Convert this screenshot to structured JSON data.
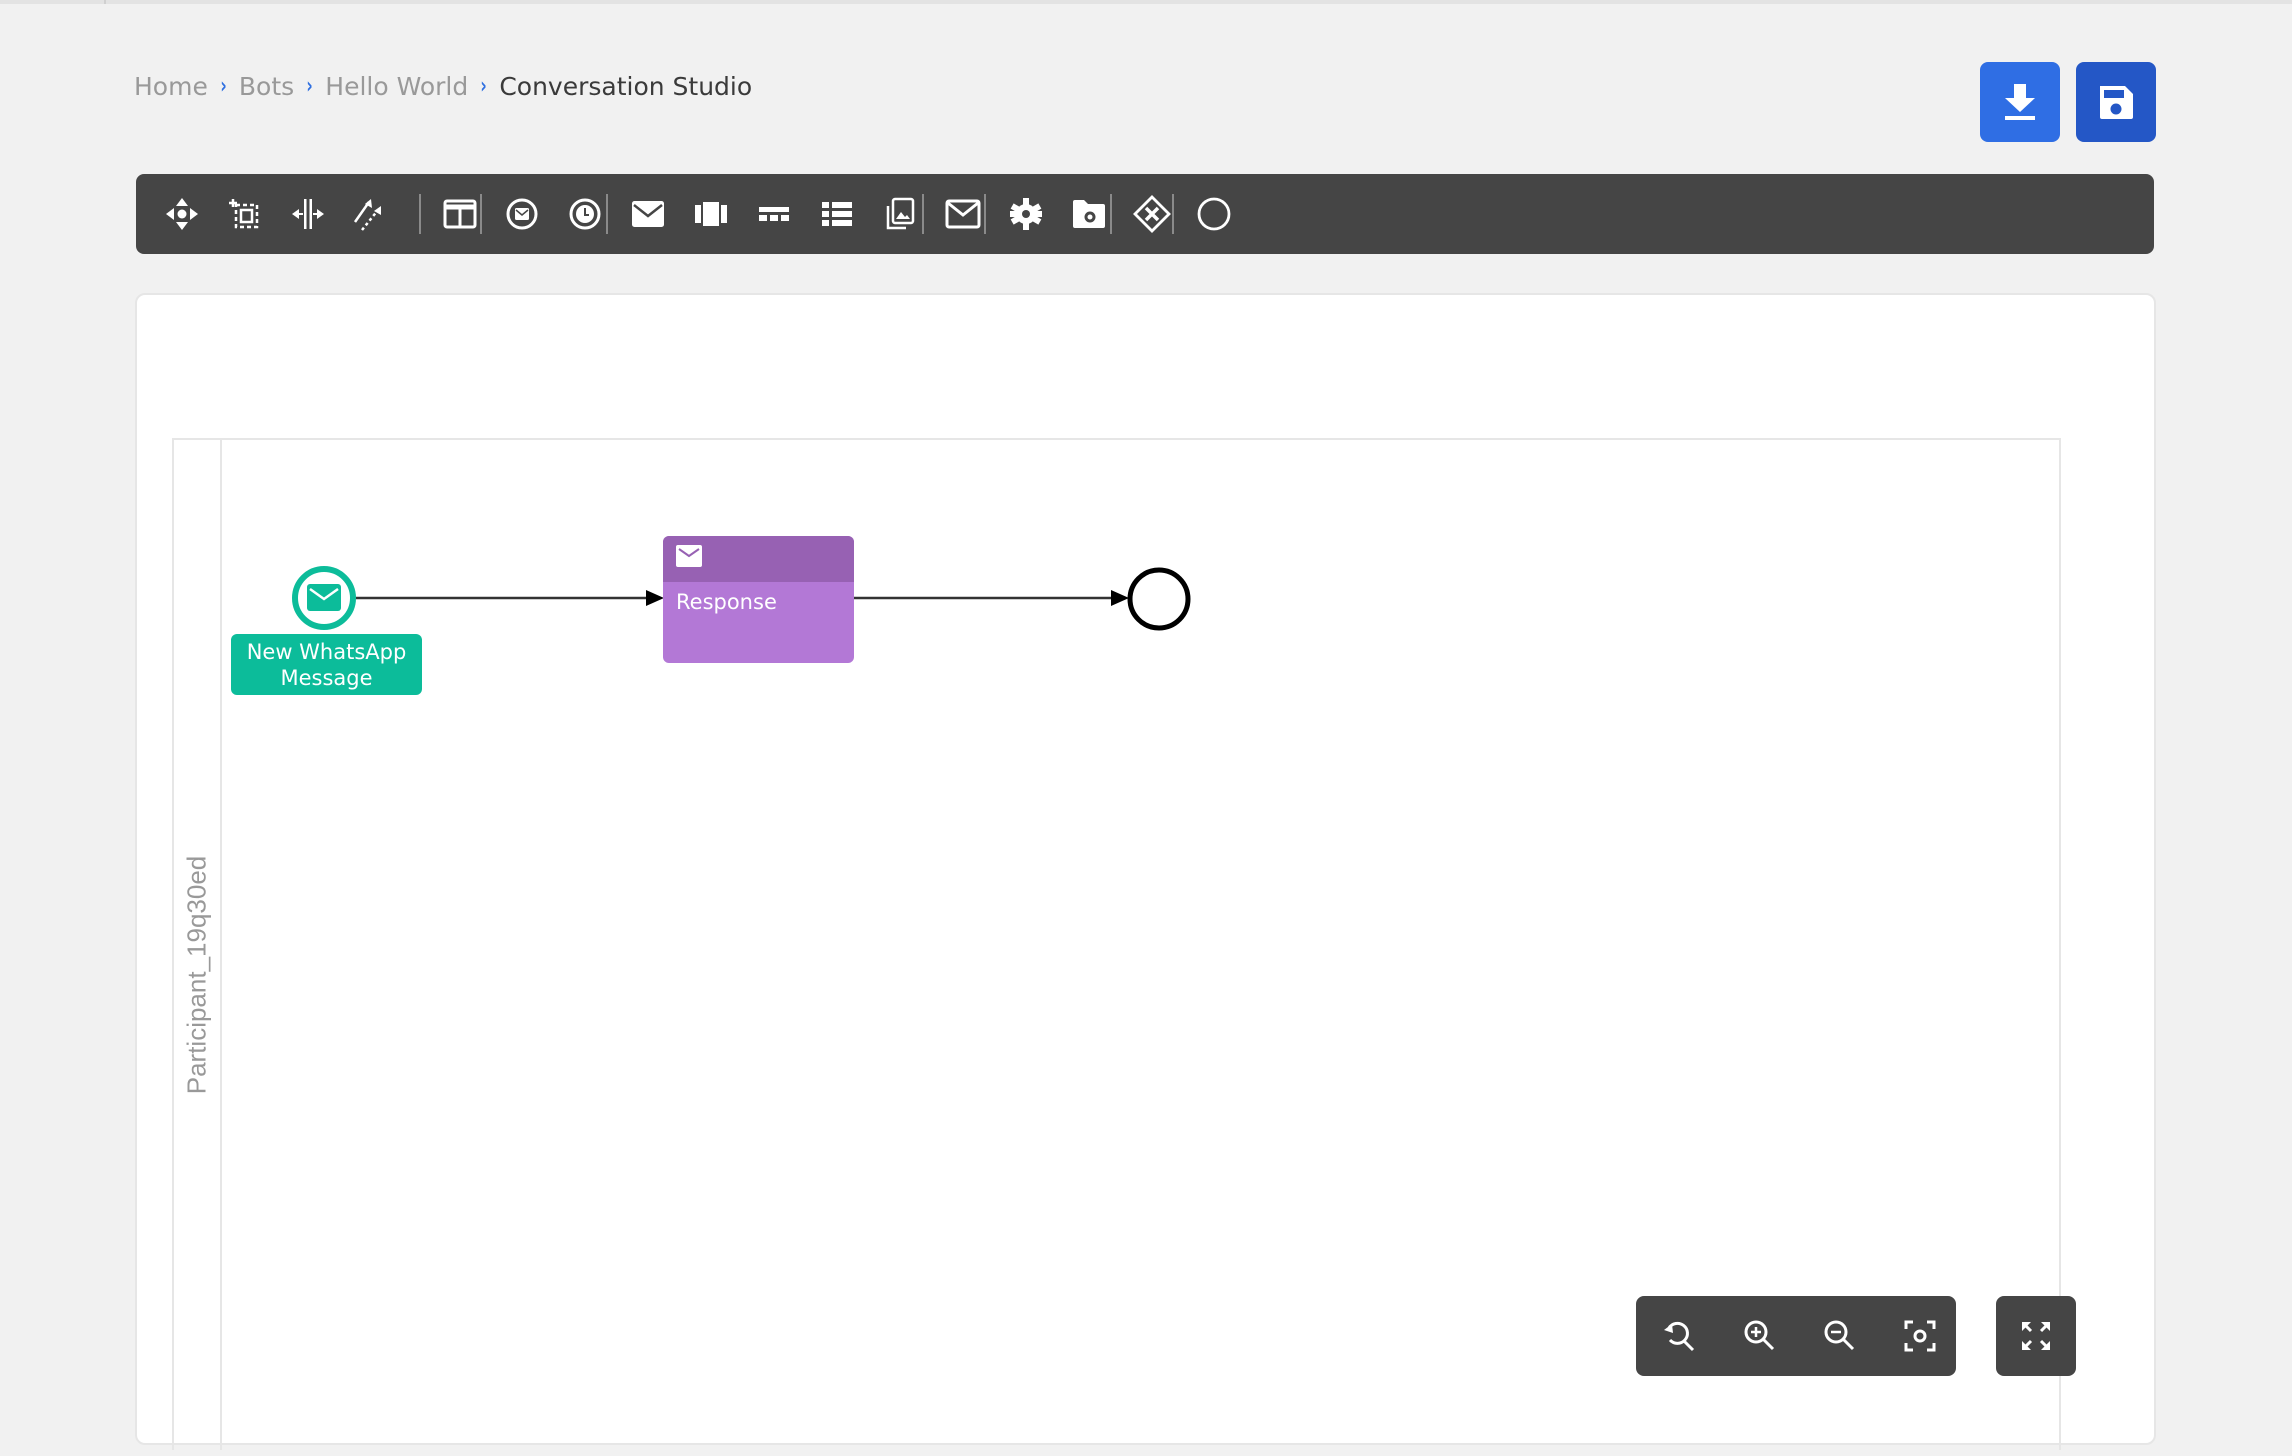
{
  "breadcrumb": {
    "items": [
      {
        "label": "Home"
      },
      {
        "label": "Bots"
      },
      {
        "label": "Hello World"
      },
      {
        "label": "Conversation Studio"
      }
    ],
    "separator": "›"
  },
  "actions": {
    "download": {
      "icon": "download-icon",
      "color": "#2f6ee4"
    },
    "save": {
      "icon": "save-icon",
      "color": "#2457c6"
    }
  },
  "toolbar": {
    "tools": [
      {
        "icon": "hand-move-icon"
      },
      {
        "icon": "lasso-select-icon"
      },
      {
        "icon": "space-tool-icon"
      },
      {
        "icon": "connect-arrow-icon"
      },
      {
        "icon": "pool-lane-icon"
      },
      {
        "icon": "message-event-icon"
      },
      {
        "icon": "timer-event-icon"
      },
      {
        "icon": "envelope-filled-icon"
      },
      {
        "icon": "carousel-icon"
      },
      {
        "icon": "buttons-icon"
      },
      {
        "icon": "list-icon"
      },
      {
        "icon": "media-gallery-icon"
      },
      {
        "icon": "envelope-outline-icon"
      },
      {
        "icon": "gear-icon"
      },
      {
        "icon": "folder-gear-icon"
      },
      {
        "icon": "exclusive-gateway-icon"
      },
      {
        "icon": "end-event-icon"
      }
    ]
  },
  "diagram": {
    "pool_label": "Participant_19q30ed",
    "start_event": {
      "label": "New WhatsApp Message",
      "color": "#0cbc9a"
    },
    "task": {
      "label": "Response",
      "header_color": "#9761b3",
      "body_color": "#b378d6"
    },
    "end_event": {
      "label": ""
    }
  },
  "canvas_controls": {
    "reset_zoom": {
      "icon": "reset-zoom-icon"
    },
    "zoom_in": {
      "icon": "zoom-in-icon"
    },
    "zoom_out": {
      "icon": "zoom-out-icon"
    },
    "fit": {
      "icon": "fit-view-icon"
    },
    "fullscreen": {
      "icon": "fullscreen-icon"
    }
  }
}
